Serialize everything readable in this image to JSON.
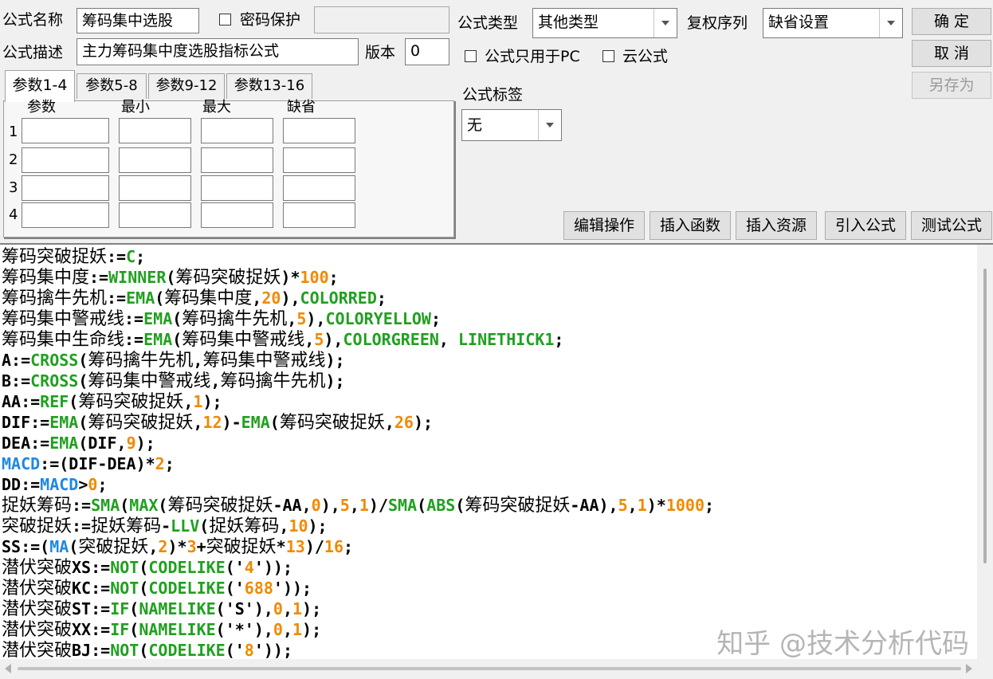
{
  "formula": {
    "name_label": "公式名称",
    "name_value": "筹码集中选股",
    "password_label": "密码保护",
    "password_value": "",
    "desc_label": "公式描述",
    "desc_value": "主力筹码集中度选股指标公式",
    "version_label": "版本",
    "version_value": "0",
    "type_label": "公式类型",
    "type_value": "其他类型",
    "restore_label": "复权序列",
    "restore_value": "缺省设置",
    "pc_only_label": "公式只用于PC",
    "cloud_label": "云公式",
    "tag_label": "公式标签",
    "tag_value": "无"
  },
  "buttons": {
    "ok": "确  定",
    "cancel": "取  消",
    "save_as": "另存为",
    "edit_ops": "编辑操作",
    "insert_func": "插入函数",
    "insert_res": "插入资源",
    "import_formula": "引入公式",
    "test_formula": "测试公式"
  },
  "params": {
    "tabs": [
      "参数1-4",
      "参数5-8",
      "参数9-12",
      "参数13-16"
    ],
    "columns": [
      "参数",
      "最小",
      "最大",
      "缺省"
    ],
    "rows": [
      "1",
      "2",
      "3",
      "4"
    ]
  },
  "code_lines": [
    [
      [
        "t",
        "筹码突破捉妖"
      ],
      [
        "o",
        ":="
      ],
      [
        "k",
        "C"
      ],
      [
        "o",
        ";"
      ]
    ],
    [
      [
        "t",
        "筹码集中度"
      ],
      [
        "o",
        ":="
      ],
      [
        "k",
        "WINNER"
      ],
      [
        "o",
        "("
      ],
      [
        "t",
        "筹码突破捉妖"
      ],
      [
        "o",
        ")*"
      ],
      [
        "n",
        "100"
      ],
      [
        "o",
        ";"
      ]
    ],
    [
      [
        "t",
        "筹码擒牛先机"
      ],
      [
        "o",
        ":="
      ],
      [
        "k",
        "EMA"
      ],
      [
        "o",
        "("
      ],
      [
        "t",
        "筹码集中度"
      ],
      [
        "o",
        ","
      ],
      [
        "n",
        "20"
      ],
      [
        "o",
        "),"
      ],
      [
        "k",
        "COLORRED"
      ],
      [
        "o",
        ";"
      ]
    ],
    [
      [
        "t",
        "筹码集中警戒线"
      ],
      [
        "o",
        ":="
      ],
      [
        "k",
        "EMA"
      ],
      [
        "o",
        "("
      ],
      [
        "t",
        "筹码擒牛先机"
      ],
      [
        "o",
        ","
      ],
      [
        "n",
        "5"
      ],
      [
        "o",
        "),"
      ],
      [
        "k",
        "COLORYELLOW"
      ],
      [
        "o",
        ";"
      ]
    ],
    [
      [
        "t",
        "筹码集中生命线"
      ],
      [
        "o",
        ":="
      ],
      [
        "k",
        "EMA"
      ],
      [
        "o",
        "("
      ],
      [
        "t",
        "筹码集中警戒线"
      ],
      [
        "o",
        ","
      ],
      [
        "n",
        "5"
      ],
      [
        "o",
        "),"
      ],
      [
        "k",
        "COLORGREEN"
      ],
      [
        "o",
        ", "
      ],
      [
        "k",
        "LINETHICK1"
      ],
      [
        "o",
        ";"
      ]
    ],
    [
      [
        "o",
        "A:="
      ],
      [
        "k",
        "CROSS"
      ],
      [
        "o",
        "("
      ],
      [
        "t",
        "筹码擒牛先机"
      ],
      [
        "o",
        ","
      ],
      [
        "t",
        "筹码集中警戒线"
      ],
      [
        "o",
        ");"
      ]
    ],
    [
      [
        "o",
        "B:="
      ],
      [
        "k",
        "CROSS"
      ],
      [
        "o",
        "("
      ],
      [
        "t",
        "筹码集中警戒线"
      ],
      [
        "o",
        ","
      ],
      [
        "t",
        "筹码擒牛先机"
      ],
      [
        "o",
        ");"
      ]
    ],
    [
      [
        "o",
        "AA:="
      ],
      [
        "k",
        "REF"
      ],
      [
        "o",
        "("
      ],
      [
        "t",
        "筹码突破捉妖"
      ],
      [
        "o",
        ","
      ],
      [
        "n",
        "1"
      ],
      [
        "o",
        ");"
      ]
    ],
    [
      [
        "o",
        "DIF:="
      ],
      [
        "k",
        "EMA"
      ],
      [
        "o",
        "("
      ],
      [
        "t",
        "筹码突破捉妖"
      ],
      [
        "o",
        ","
      ],
      [
        "n",
        "12"
      ],
      [
        "o",
        ")-"
      ],
      [
        "k",
        "EMA"
      ],
      [
        "o",
        "("
      ],
      [
        "t",
        "筹码突破捉妖"
      ],
      [
        "o",
        ","
      ],
      [
        "n",
        "26"
      ],
      [
        "o",
        ");"
      ]
    ],
    [
      [
        "o",
        "DEA:="
      ],
      [
        "k",
        "EMA"
      ],
      [
        "o",
        "(DIF,"
      ],
      [
        "n",
        "9"
      ],
      [
        "o",
        ");"
      ]
    ],
    [
      [
        "b",
        "MACD"
      ],
      [
        "o",
        ":=(DIF-DEA)*"
      ],
      [
        "n",
        "2"
      ],
      [
        "o",
        ";"
      ]
    ],
    [
      [
        "o",
        "DD:="
      ],
      [
        "b",
        "MACD"
      ],
      [
        "o",
        ">"
      ],
      [
        "n",
        "0"
      ],
      [
        "o",
        ";"
      ]
    ],
    [
      [
        "t",
        "捉妖筹码"
      ],
      [
        "o",
        ":="
      ],
      [
        "k",
        "SMA"
      ],
      [
        "o",
        "("
      ],
      [
        "k",
        "MAX"
      ],
      [
        "o",
        "("
      ],
      [
        "t",
        "筹码突破捉妖"
      ],
      [
        "o",
        "-AA,"
      ],
      [
        "n",
        "0"
      ],
      [
        "o",
        "),"
      ],
      [
        "n",
        "5"
      ],
      [
        "o",
        ","
      ],
      [
        "n",
        "1"
      ],
      [
        "o",
        ")/"
      ],
      [
        "k",
        "SMA"
      ],
      [
        "o",
        "("
      ],
      [
        "k",
        "ABS"
      ],
      [
        "o",
        "("
      ],
      [
        "t",
        "筹码突破捉妖"
      ],
      [
        "o",
        "-AA),"
      ],
      [
        "n",
        "5"
      ],
      [
        "o",
        ","
      ],
      [
        "n",
        "1"
      ],
      [
        "o",
        ")*"
      ],
      [
        "n",
        "1000"
      ],
      [
        "o",
        ";"
      ]
    ],
    [
      [
        "t",
        "突破捉妖"
      ],
      [
        "o",
        ":="
      ],
      [
        "t",
        "捉妖筹码"
      ],
      [
        "o",
        "-"
      ],
      [
        "k",
        "LLV"
      ],
      [
        "o",
        "("
      ],
      [
        "t",
        "捉妖筹码"
      ],
      [
        "o",
        ","
      ],
      [
        "n",
        "10"
      ],
      [
        "o",
        ");"
      ]
    ],
    [
      [
        "o",
        "SS:=("
      ],
      [
        "b",
        "MA"
      ],
      [
        "o",
        "("
      ],
      [
        "t",
        "突破捉妖"
      ],
      [
        "o",
        ","
      ],
      [
        "n",
        "2"
      ],
      [
        "o",
        ")*"
      ],
      [
        "n",
        "3"
      ],
      [
        "o",
        "+"
      ],
      [
        "t",
        "突破捉妖"
      ],
      [
        "o",
        "*"
      ],
      [
        "n",
        "13"
      ],
      [
        "o",
        ")/"
      ],
      [
        "n",
        "16"
      ],
      [
        "o",
        ";"
      ]
    ],
    [
      [
        "t",
        "潜伏突破"
      ],
      [
        "o",
        "XS:="
      ],
      [
        "k",
        "NOT"
      ],
      [
        "o",
        "("
      ],
      [
        "k",
        "CODELIKE"
      ],
      [
        "o",
        "('"
      ],
      [
        "n",
        "4"
      ],
      [
        "o",
        "'));"
      ]
    ],
    [
      [
        "t",
        "潜伏突破"
      ],
      [
        "o",
        "KC:="
      ],
      [
        "k",
        "NOT"
      ],
      [
        "o",
        "("
      ],
      [
        "k",
        "CODELIKE"
      ],
      [
        "o",
        "('"
      ],
      [
        "n",
        "688"
      ],
      [
        "o",
        "'));"
      ]
    ],
    [
      [
        "t",
        "潜伏突破"
      ],
      [
        "o",
        "ST:="
      ],
      [
        "k",
        "IF"
      ],
      [
        "o",
        "("
      ],
      [
        "k",
        "NAMELIKE"
      ],
      [
        "o",
        "('S'),"
      ],
      [
        "n",
        "0"
      ],
      [
        "o",
        ","
      ],
      [
        "n",
        "1"
      ],
      [
        "o",
        ");"
      ]
    ],
    [
      [
        "t",
        "潜伏突破"
      ],
      [
        "o",
        "XX:="
      ],
      [
        "k",
        "IF"
      ],
      [
        "o",
        "("
      ],
      [
        "k",
        "NAMELIKE"
      ],
      [
        "o",
        "('*'),"
      ],
      [
        "n",
        "0"
      ],
      [
        "o",
        ","
      ],
      [
        "n",
        "1"
      ],
      [
        "o",
        ");"
      ]
    ],
    [
      [
        "t",
        "潜伏突破"
      ],
      [
        "o",
        "BJ:="
      ],
      [
        "k",
        "NOT"
      ],
      [
        "o",
        "("
      ],
      [
        "k",
        "CODELIKE"
      ],
      [
        "o",
        "('"
      ],
      [
        "n",
        "8"
      ],
      [
        "o",
        "'));"
      ]
    ]
  ],
  "watermark": "知乎 @技术分析代码",
  "colors": {
    "keyword": "#20a020",
    "number": "#f08a00",
    "builtin": "#1e88e5"
  }
}
